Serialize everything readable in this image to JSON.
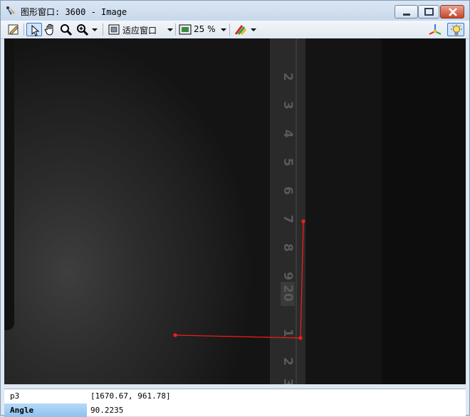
{
  "window": {
    "title": "图形窗口: 3600 - Image"
  },
  "toolbar": {
    "fit_mode": "适应窗口",
    "zoom": "25 %"
  },
  "ruler": {
    "numbers": [
      "2",
      "3",
      "4",
      "5",
      "6",
      "7",
      "8",
      "9",
      "20",
      "1",
      "2",
      "3"
    ]
  },
  "properties": [
    {
      "key": "p3",
      "value": "[1670.67, 961.78]"
    },
    {
      "key": "Angle",
      "value": "90.2235"
    }
  ],
  "colors": {
    "overlay_line": "#ff1a1a",
    "selected_row": "#8cc2ee"
  },
  "icons": [
    "app-icon",
    "minimize-icon",
    "maximize-icon",
    "close-icon",
    "edit-icon",
    "pointer-icon",
    "pan-hand-icon",
    "magnifier-icon",
    "zoom-in-icon",
    "fit-window-icon",
    "zoom-percent-icon",
    "color-tools-icon",
    "3d-axes-icon",
    "lightbulb-icon"
  ]
}
